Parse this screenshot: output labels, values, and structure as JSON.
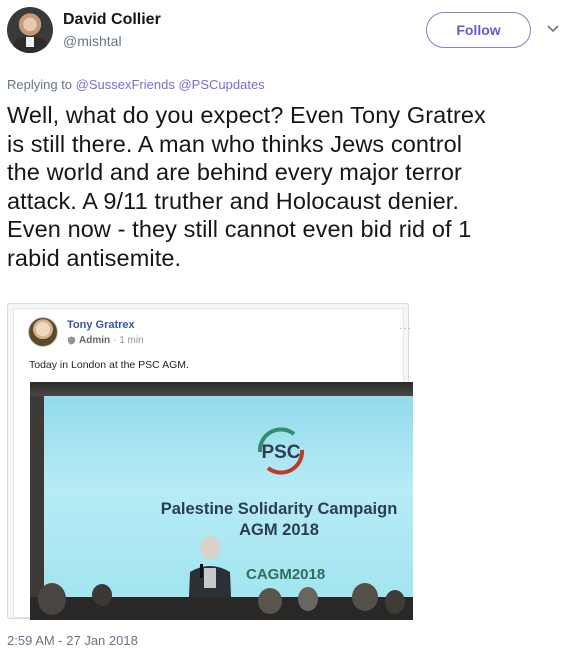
{
  "author": {
    "name": "David Collier",
    "handle": "@mishtal",
    "follow_label": "Follow"
  },
  "reply": {
    "prefix": "Replying to",
    "mentions": [
      "@SussexFriends",
      "@PSCupdates"
    ]
  },
  "tweet": {
    "text_lines": [
      "Well, what do you expect? Even Tony Gratrex",
      "is still there. A man who thinks Jews control",
      "the world and are behind every major terror",
      "attack. A 9/11 truther and Holocaust denier.",
      "Even now - they still cannot even bid rid of 1",
      "rabid antisemite."
    ],
    "timestamp": "2:59 AM - 27 Jan 2018"
  },
  "embedded_post": {
    "name": "Tony Gratrex",
    "role": "Admin",
    "time": "· 1 min",
    "more": "···",
    "text": "Today in London at the PSC AGM.",
    "photo": {
      "logo_text": "PSC",
      "title_line1": "Palestine Solidarity Campaign",
      "title_line2": "AGM 2018",
      "hashtag": "CAGM2018"
    }
  },
  "colors": {
    "follow_accent": "#6a5acd",
    "link": "#7b6bd0",
    "fb_name": "#365899"
  }
}
